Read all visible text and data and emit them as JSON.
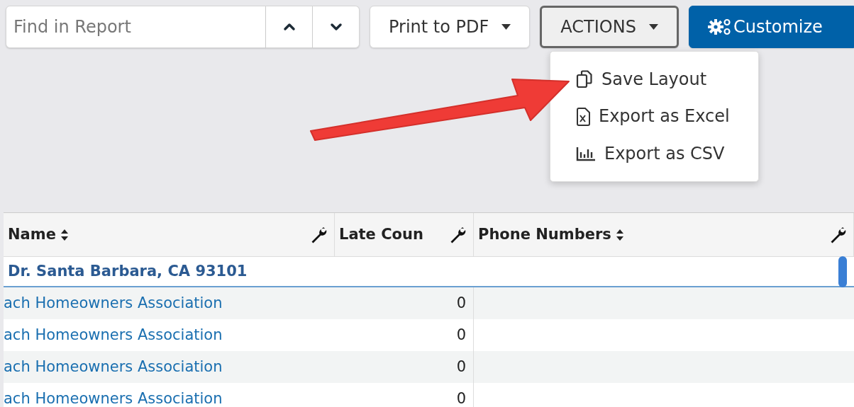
{
  "search": {
    "placeholder": "Find in Report"
  },
  "toolbar": [
    {
      "label": "Print to PDF",
      "kind": "dropdown",
      "expanded": false
    },
    {
      "label": "ACTIONS",
      "kind": "dropdown",
      "expanded": true
    },
    {
      "label": "Customize",
      "kind": "primary"
    }
  ],
  "menu": {
    "items": [
      {
        "label": "Save Layout"
      },
      {
        "label": "Export as Excel"
      },
      {
        "label": "Export as CSV"
      }
    ]
  },
  "table": {
    "columns": [
      {
        "label": "Name",
        "sortable": true
      },
      {
        "label": "Late Coun",
        "sortable": false
      },
      {
        "label": "Phone Numbers",
        "sortable": true
      }
    ],
    "group": "Dr. Santa Barbara, CA 93101",
    "rows": [
      {
        "name": "ach Homeowners Association",
        "late_count": "0"
      },
      {
        "name": "ach Homeowners Association",
        "late_count": "0"
      },
      {
        "name": "ach Homeowners Association",
        "late_count": "0"
      },
      {
        "name": "ach Homeowners Association",
        "late_count": "0"
      }
    ]
  }
}
